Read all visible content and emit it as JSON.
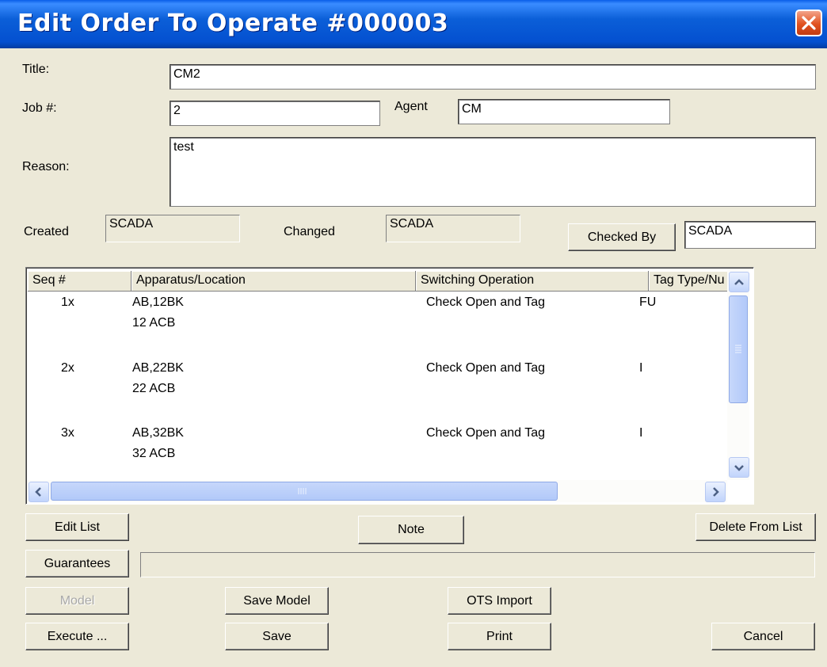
{
  "window": {
    "title": "Edit Order To Operate #000003"
  },
  "form": {
    "title_label": "Title:",
    "title_value": "CM2",
    "job_label": "Job #:",
    "job_value": "2",
    "agent_label": "Agent",
    "agent_value": "CM",
    "reason_label": "Reason:",
    "reason_value": "test",
    "created_label": "Created",
    "created_value": "SCADA",
    "changed_label": "Changed",
    "changed_value": "SCADA",
    "checked_by_button": "Checked By",
    "checked_by_value": "SCADA"
  },
  "table": {
    "columns": [
      "Seq #",
      "Apparatus/Location",
      "Switching Operation",
      "Tag Type/Nu"
    ],
    "rows": [
      {
        "seq": "1x",
        "apparatus": "AB,12BK",
        "location": "12 ACB",
        "operation": "Check Open and Tag",
        "tag": "FU"
      },
      {
        "seq": "2x",
        "apparatus": "AB,22BK",
        "location": "22 ACB",
        "operation": "Check Open and Tag",
        "tag": "I"
      },
      {
        "seq": "3x",
        "apparatus": "AB,32BK",
        "location": "32 ACB",
        "operation": "Check Open and Tag",
        "tag": "I"
      }
    ]
  },
  "buttons": {
    "edit_list": "Edit List",
    "note": "Note",
    "delete_from_list": "Delete From List",
    "guarantees": "Guarantees",
    "model": "Model",
    "save_model": "Save Model",
    "ots_import": "OTS Import",
    "execute": "Execute ...",
    "save": "Save",
    "print": "Print",
    "cancel": "Cancel"
  },
  "icons": {
    "close": "close-icon",
    "scroll_up": "chevron-up-icon",
    "scroll_down": "chevron-down-icon",
    "scroll_left": "chevron-left-icon",
    "scroll_right": "chevron-right-icon"
  },
  "colors": {
    "titlebar": "#0450d0",
    "close_button": "#e1521f",
    "dialog_background": "#ece9d8"
  }
}
